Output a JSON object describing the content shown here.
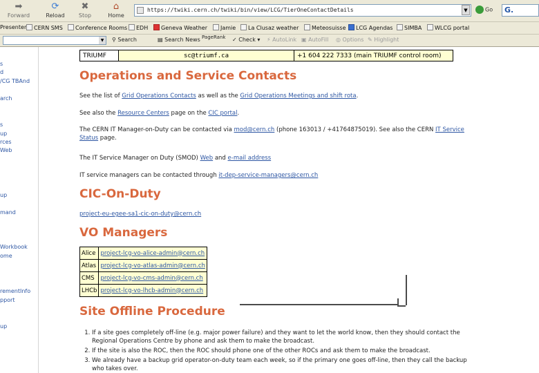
{
  "toolbar": {
    "forward_label": "Forward",
    "reload_label": "Reload",
    "stop_label": "Stop",
    "home_label": "Home",
    "url": "https://twiki.cern.ch/twiki/bin/view/LCG/TierOneContactDetails",
    "go_label": "Go",
    "search_logo": "G."
  },
  "bookmarks": [
    "Presenter",
    "CERN SMS",
    "Conference Rooms",
    "EDH",
    "Geneva Weather",
    "Jamie",
    "La Clusaz weather",
    "Meteosuisse",
    "LCG Agendas",
    "SIMBA",
    "WLCG portal"
  ],
  "google_toolbar": {
    "search": "Search",
    "search_news": "Search News",
    "pagerank": "PageRank",
    "check": "Check",
    "autolink": "AutoLink",
    "autofill": "AutoFill",
    "options": "Options",
    "highlight": "Highlight"
  },
  "sidebar": {
    "items": [
      "s",
      "d",
      "/CG TBAnd",
      "arch",
      "s",
      "up",
      "rces",
      "Web",
      "up",
      "mand",
      "Workbook",
      "ome",
      "rementInfo",
      "pport",
      "up"
    ]
  },
  "triumf_row": {
    "site": "TRIUMF",
    "email": "sc@triumf.ca",
    "phone": "+1 604 222 7333 (main TRIUMF control room)"
  },
  "ops": {
    "heading": "Operations and Service Contacts",
    "p1_a": "See the list of ",
    "p1_link1": "Grid Operations Contacts",
    "p1_b": " as well as the ",
    "p1_link2": "Grid Operations Meetings and shift rota",
    "p1_c": ".",
    "p2_a": "See also the ",
    "p2_link1": "Resource Centers",
    "p2_b": " page on the ",
    "p2_link2": "CIC portal",
    "p2_c": ".",
    "p3_a": "The CERN IT Manager-on-Duty can be contacted via ",
    "p3_link1": "mod@cern.ch",
    "p3_b": " (phone 163013 / +41764875019). See also the CERN ",
    "p3_link2": "IT Service",
    "p3_link3": "Status",
    "p3_c": " page.",
    "p4_a": "The IT Service Manager on Duty (SMOD) ",
    "p4_link1": "Web",
    "p4_b": " and ",
    "p4_link2": "e-mail address",
    "p5_a": "IT service managers can be contacted through ",
    "p5_link1": "it-dep-service-managers@cern.ch"
  },
  "cic": {
    "heading": "CIC-On-Duty",
    "email": "project-eu-egee-sa1-cic-on-duty@cern.ch"
  },
  "vo": {
    "heading": "VO Managers",
    "rows": [
      {
        "vo": "Alice",
        "email": "project-lcg-vo-alice-admin@cern.ch"
      },
      {
        "vo": "Atlas",
        "email": "project-lcg-vo-atlas-admin@cern.ch"
      },
      {
        "vo": "CMS",
        "email": "project-lcg-vo-cms-admin@cern.ch"
      },
      {
        "vo": "LHCb",
        "email": "project-lcg-vo-lhcb-admin@cern.ch"
      }
    ]
  },
  "site_offline": {
    "heading": "Site Offline Procedure",
    "items": [
      "If a site goes completely off-line (e.g. major power failure) and they want to let the world know, then they should contact the",
      "Regional Operations Centre by phone and ask them to make the broadcast.",
      "If the site is also the ROC, then the ROC should phone one of the other ROCs and ask them to make the broadcast.",
      "We already have a backup grid operator-on-duty team each week, so if the primary one goes off-line, then they call the backup",
      "who takes over."
    ]
  }
}
